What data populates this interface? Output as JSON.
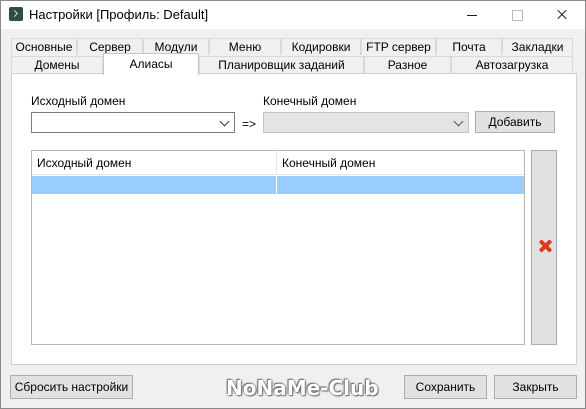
{
  "window": {
    "title": "Настройки [Профиль: Default]"
  },
  "tabs": {
    "row1": [
      "Основные",
      "Сервер",
      "Модули",
      "Меню",
      "Кодировки",
      "FTP сервер",
      "Почта",
      "Закладки"
    ],
    "row2": [
      "Домены",
      "Алиасы",
      "Планировщик заданий",
      "Разное",
      "Автозагрузка"
    ],
    "active": "Алиасы"
  },
  "aliases": {
    "source_label": "Исходный домен",
    "target_label": "Конечный домен",
    "source_value": "",
    "target_value": "",
    "arrow": "=>",
    "add_button": "Добавить",
    "table": {
      "columns": [
        "Исходный домен",
        "Конечный домен"
      ],
      "rows": [
        [
          "",
          ""
        ]
      ]
    }
  },
  "footer": {
    "reset_button": "Сбросить настройки",
    "save_button": "Сохранить",
    "close_button": "Закрыть",
    "watermark": "NoNaMe-Club"
  },
  "colors": {
    "selected_row": "#99ccff",
    "delete_icon": "#e03a1e"
  },
  "icons": {
    "app": "terminal-icon",
    "delete": "red-x-icon"
  }
}
